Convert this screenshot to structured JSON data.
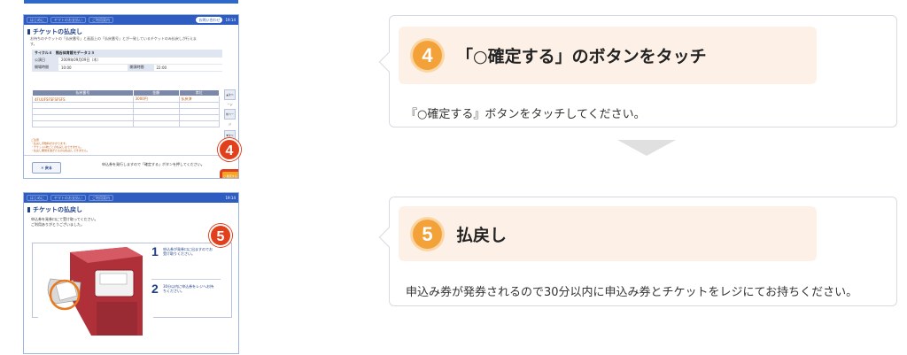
{
  "kiosk_screen_1": {
    "topbar_buttons": [
      "はじめに",
      "ヤマトのお支払い",
      "ご利用案内"
    ],
    "status_pill": "お問い合わせ",
    "time": "19:14",
    "title": "チケットの払戻し",
    "description": "お持ちのチケットの「払戻番号」と画面上の「払戻番号」とが一致しているチケットのみ払戻しが行えます。",
    "event_name": "サイクル４　熊谷体育館モデータ２３",
    "info_rows": [
      {
        "label": "公演日",
        "value": "2009年09月09日（木）",
        "extra_label": "",
        "extra_value": ""
      },
      {
        "label": "開場時間",
        "value": "10:00",
        "extra_label": "開演時間",
        "extra_value": "22:00"
      }
    ],
    "grid_headers": [
      "払戻番号",
      "金額",
      "席位"
    ],
    "grid_first_row": [
      "4FUUFSFSFSFSFS",
      "3000円",
      "払戻済"
    ],
    "side_buttons": [
      "▲次ページ",
      "前ページ",
      "▼次ページ"
    ],
    "notes": "ご注意\n・払戻し手数料がかかります。\n・チケット1枚ごとの払戻しはできません。\n・払戻し期間を過ぎたものは払戻しできません。",
    "back_button": "✕ 戻る",
    "bottom_message": "申込券を発行しますので「確定する」ボタンを押してください。",
    "confirm_button": "○ 確定する",
    "badge": "4"
  },
  "kiosk_screen_2": {
    "topbar_buttons": [
      "はじめに",
      "ヤマトのお支払い",
      "ご利用案内"
    ],
    "time": "19:14",
    "title": "チケットの払戻し",
    "description": "申込券を発券口にて受け取ってください。\nご利用ありがとうございました。",
    "steps": [
      {
        "num": "1",
        "text": "申込券が発券口に出ますのでお受け取りください。"
      },
      {
        "num": "2",
        "text": "30分以内に申込券をレジへお持ちください。"
      }
    ],
    "badge": "5"
  },
  "step_cards": [
    {
      "number": "4",
      "title": "「○確定する」のボタンをタッチ",
      "body": "『○確定する』ボタンをタッチしてください。"
    },
    {
      "number": "5",
      "title": "払戻し",
      "body": "申込み券が発券されるので30分以内に申込み券とチケットをレジにてお持ちください。"
    }
  ],
  "colors": {
    "kiosk_blue": "#2e5cc0",
    "badge_red": "#e2401c",
    "step_orange": "#f3a23a",
    "card_head_bg": "#fdf1e7"
  }
}
